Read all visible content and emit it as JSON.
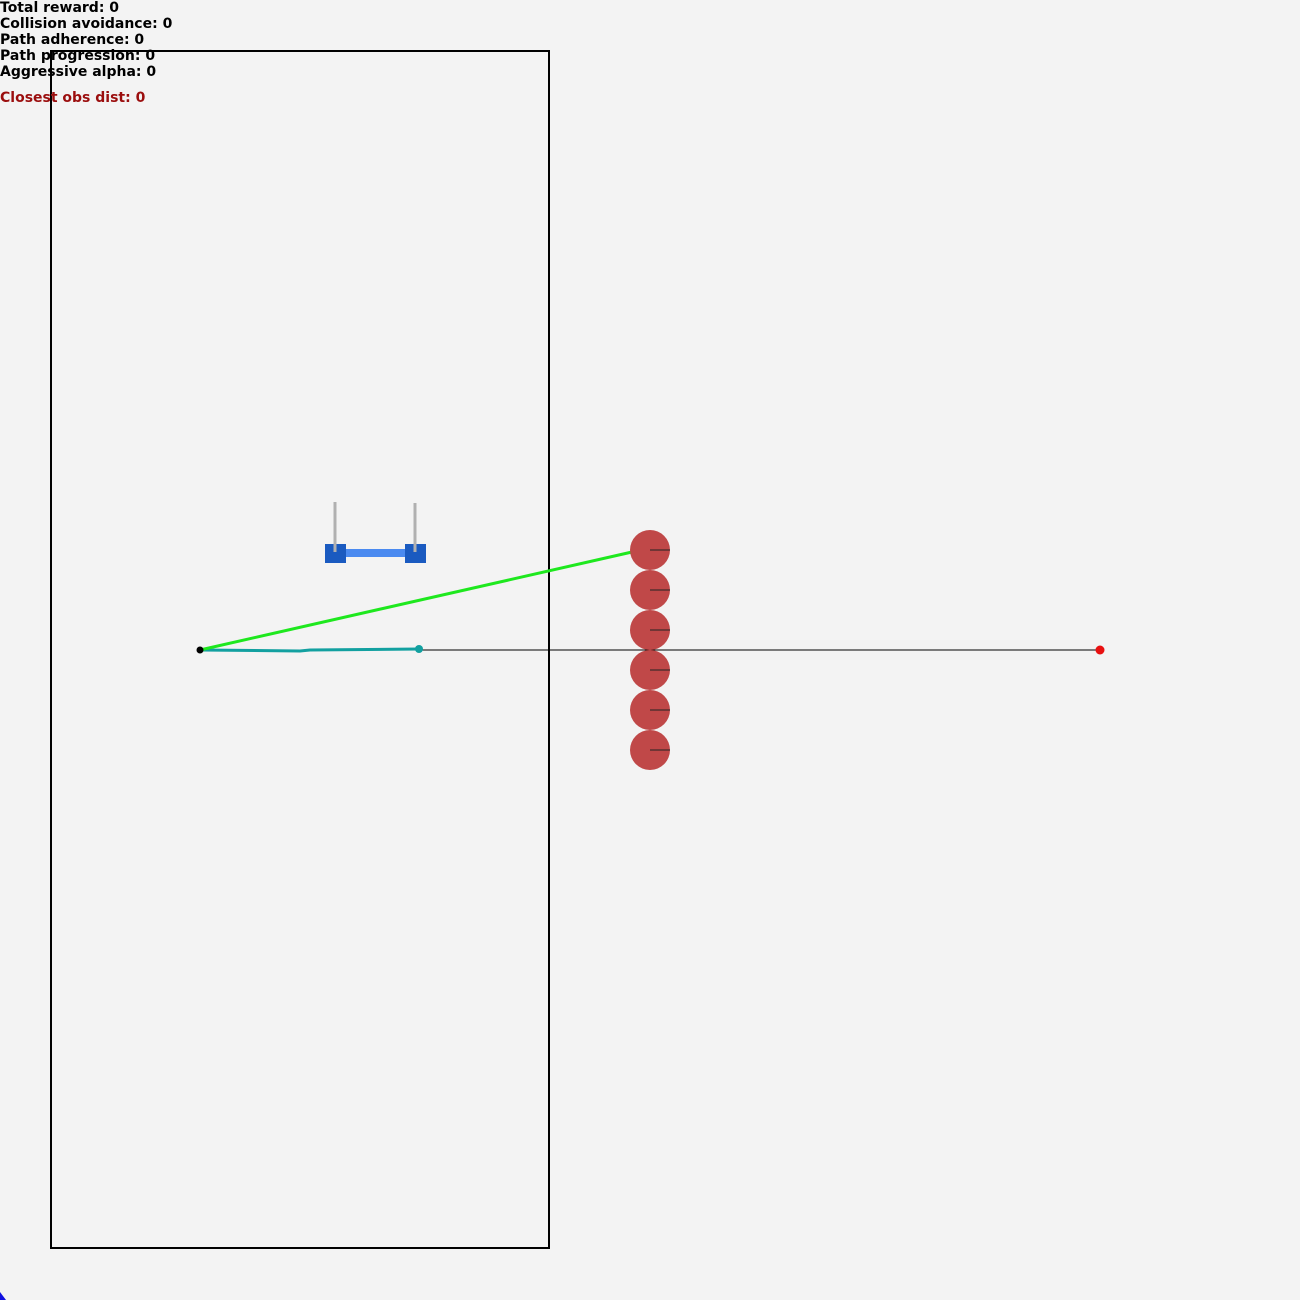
{
  "hud": {
    "total_reward": "Total reward: 0",
    "collision_avoidance": "Collision avoidance: 0",
    "path_adherence": "Path adherence: 0",
    "path_progression": "Path progression: 0",
    "aggressive_alpha": "Aggressive alpha: 0",
    "closest_obs_dist": "Closest obs dist: 0"
  },
  "colors": {
    "background": "#f3f3f3",
    "boundary": "#000000",
    "path_line": "#000000",
    "lookahead_ray": "#1ee81e",
    "agent_track": "#12a0a0",
    "obstacle": "#c04848",
    "goal": "#e81010",
    "robot_body": "#4a8af0",
    "robot_wheel": "#1a5ac0",
    "robot_antenna": "#b0b0b0",
    "closest_text": "#9b0e0e"
  },
  "icons": {
    "goal": "red-goal-dot",
    "start": "black-start-dot",
    "robot": "two-wheeled-robot",
    "obstacle": "red-circle-obstacle"
  }
}
